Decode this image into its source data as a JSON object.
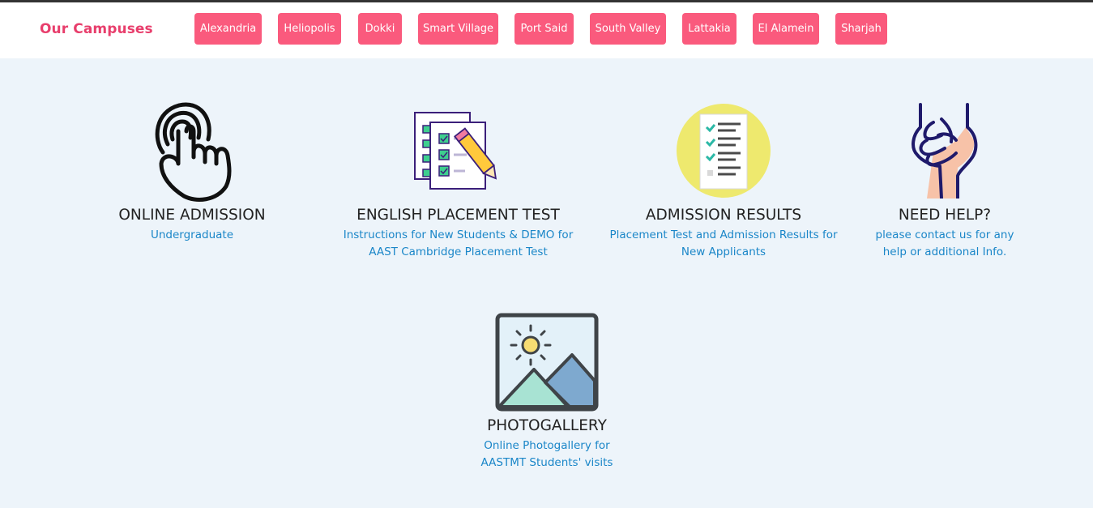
{
  "header": {
    "title": "Our Campuses",
    "campuses": [
      "Alexandria",
      "Heliopolis",
      "Dokki",
      "Smart Village",
      "Port Said",
      "South Valley",
      "Lattakia",
      "El Alamein",
      "Sharjah"
    ]
  },
  "cards": [
    {
      "title": "ONLINE ADMISSION",
      "desc": "Undergraduate",
      "icon": "tap-hand-icon"
    },
    {
      "title": "ENGLISH PLACEMENT TEST",
      "desc": "Instructions for New Students & DEMO for AAST Cambridge Placement Test",
      "icon": "checklist-pencil-icon"
    },
    {
      "title": "ADMISSION RESULTS",
      "desc": "Placement Test and Admission Results for New Applicants",
      "icon": "results-checklist-icon"
    },
    {
      "title": "NEED HELP?",
      "desc": "please contact us for any help or additional Info.",
      "icon": "helping-hands-icon"
    },
    {
      "title": "PHOTOGALLERY",
      "desc": "Online Photogallery for AASTMT Students' visits",
      "icon": "photo-gallery-icon"
    }
  ],
  "colors": {
    "accent": "#e83e6c",
    "button": "#fa5a7d",
    "link": "#1a86c8",
    "background": "#edf4fa"
  }
}
